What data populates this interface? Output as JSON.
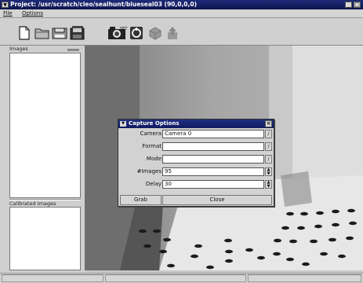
{
  "window": {
    "title": "Project: /usr/scratch/cleo/sealhunt/blueseal03 (90,0,0,0)",
    "minimize_glyph": "_",
    "maximize_glyph": "□"
  },
  "menu": [
    "File",
    "Options"
  ],
  "toolbar": {
    "icons": [
      "new-file-icon",
      "open-folder-icon",
      "save-icon",
      "save-all-icon",
      "camera-capture-icon",
      "calibrate-icon",
      "cube-icon",
      "export-icon"
    ]
  },
  "left_panel": {
    "images_label": "Images",
    "calibrated_label": "Calibrated Images"
  },
  "dialog": {
    "title": "Capture Options",
    "fields": [
      {
        "label": "Camera",
        "value": "Camera 0"
      },
      {
        "label": "Format",
        "value": ""
      },
      {
        "label": "Mode",
        "value": ""
      },
      {
        "label": "#Images",
        "value": "95"
      },
      {
        "label": "Delay",
        "value": "30"
      }
    ],
    "grab_label": "Grab",
    "close_label": "Close"
  },
  "colors": {
    "title_bar": "#0e1650",
    "dialog_title": "#101a60",
    "board": "#e6e6e6",
    "dots": "#1a1a1a"
  }
}
